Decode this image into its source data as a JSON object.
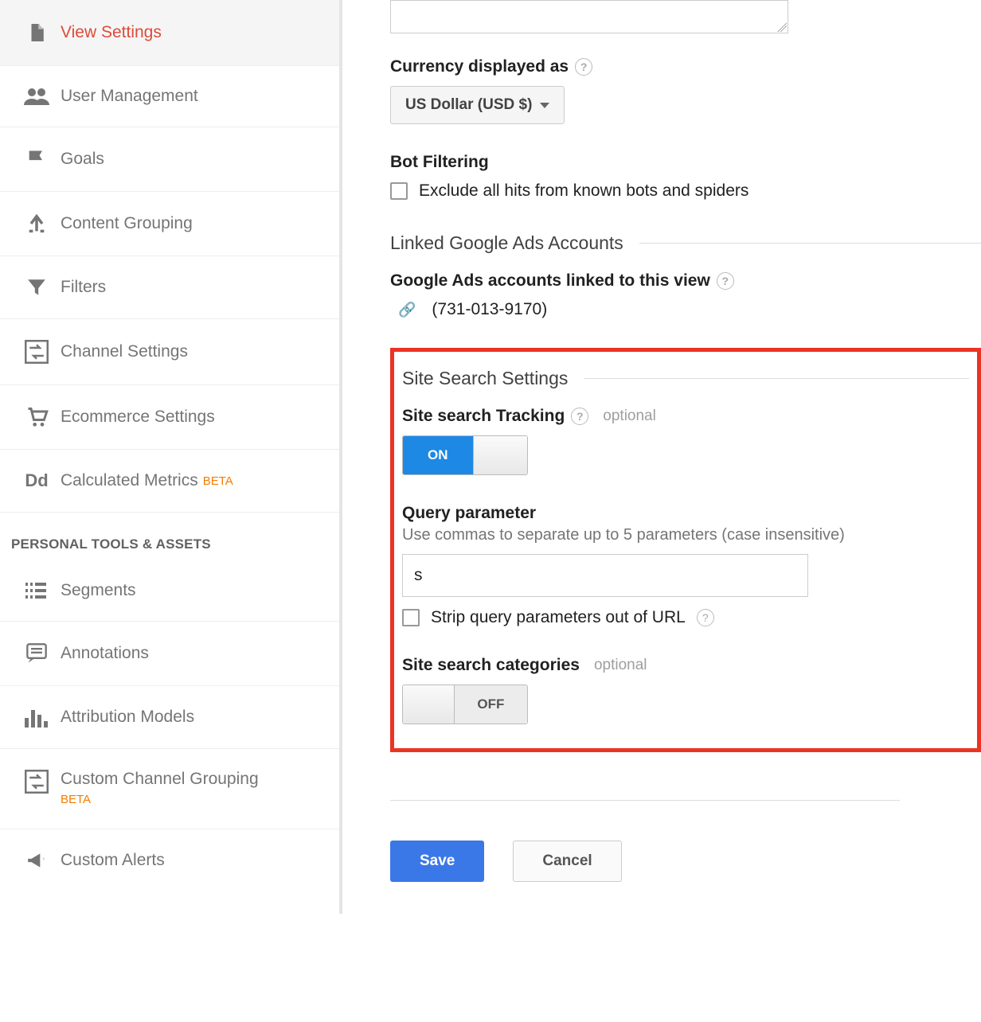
{
  "sidebar": {
    "items": [
      {
        "label": "View Settings",
        "active": true,
        "beta": false
      },
      {
        "label": "User Management",
        "active": false,
        "beta": false
      },
      {
        "label": "Goals",
        "active": false,
        "beta": false
      },
      {
        "label": "Content Grouping",
        "active": false,
        "beta": false
      },
      {
        "label": "Filters",
        "active": false,
        "beta": false
      },
      {
        "label": "Channel Settings",
        "active": false,
        "beta": false
      },
      {
        "label": "Ecommerce Settings",
        "active": false,
        "beta": false
      },
      {
        "label": "Calculated Metrics",
        "active": false,
        "beta": true
      }
    ],
    "section_header": "PERSONAL TOOLS & ASSETS",
    "personal": [
      {
        "label": "Segments",
        "beta": false
      },
      {
        "label": "Annotations",
        "beta": false
      },
      {
        "label": "Attribution Models",
        "beta": false
      },
      {
        "label": "Custom Channel Grouping",
        "beta": true
      },
      {
        "label": "Custom Alerts",
        "beta": false
      }
    ],
    "beta_label": "BETA"
  },
  "main": {
    "currency": {
      "label": "Currency displayed as",
      "value": "US Dollar (USD $)"
    },
    "bot_filtering": {
      "label": "Bot Filtering",
      "checkbox_label": "Exclude all hits from known bots and spiders"
    },
    "linked_ads": {
      "section_title": "Linked Google Ads Accounts",
      "label": "Google Ads accounts linked to this view",
      "account": "(731-013-9170)"
    },
    "site_search": {
      "section_title": "Site Search Settings",
      "tracking_label": "Site search Tracking",
      "optional": "optional",
      "toggle_on": "ON",
      "query_label": "Query parameter",
      "query_help": "Use commas to separate up to 5 parameters (case insensitive)",
      "query_value": "s",
      "strip_label": "Strip query parameters out of URL",
      "categories_label": "Site search categories",
      "toggle_off": "OFF"
    },
    "buttons": {
      "save": "Save",
      "cancel": "Cancel"
    }
  }
}
